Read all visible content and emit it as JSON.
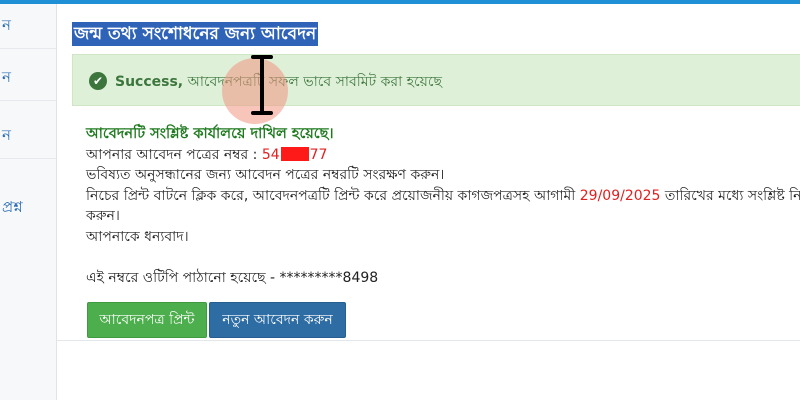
{
  "sidebar": {
    "items": [
      {
        "label": "ন"
      },
      {
        "label": "ন"
      },
      {
        "label": "ন"
      },
      {
        "label": "প্রশ্ন"
      }
    ]
  },
  "page": {
    "title": "জন্ম তথ্য সংশোধনের জন্য আবেদন"
  },
  "alert": {
    "strong": "Success,",
    "message": " আবেদনপত্রটি সফল ভাবে সাবমিট করা হয়েছে"
  },
  "result": {
    "heading": "আবেদনটি সংশ্লিষ্ট কার্যালয়ে দাখিল হয়েছে।",
    "app_number_label": "আপনার আবেদন পত্রের নম্বর : ",
    "app_number_prefix": "54",
    "app_number_suffix": "77",
    "save_note": "ভবিষ্যত অনুসন্ধানের জন্য আবেদন পত্রের নম্বরটি সংরক্ষণ করুন।",
    "print_note_before": "নিচের প্রিন্ট বাটনে ক্লিক করে, আবেদনপত্রটি প্রিন্ট করে প্রয়োজনীয় কাগজপত্রসহ আগামী ",
    "deadline_date": "29/09/2025",
    "print_note_after": " তারিখের মধ্যে সংশ্লিষ্ট নিবন্ধ",
    "print_note_cont": "করুন।",
    "thanks": "আপনাকে ধন্যবাদ।",
    "otp_note": "এই নম্বরে ওটিপি পাঠানো হয়েছে - *********8498"
  },
  "buttons": {
    "print": "আবেদনপত্র প্রিন্ট",
    "new": "নতুন আবেদন করুন"
  },
  "colors": {
    "title_bg": "#2f63b8",
    "alert_bg": "#dff0d8",
    "heading_green": "#1f7a1f",
    "accent_red": "#e02020",
    "btn_green": "#4cae4c",
    "btn_blue": "#2e6da4"
  }
}
